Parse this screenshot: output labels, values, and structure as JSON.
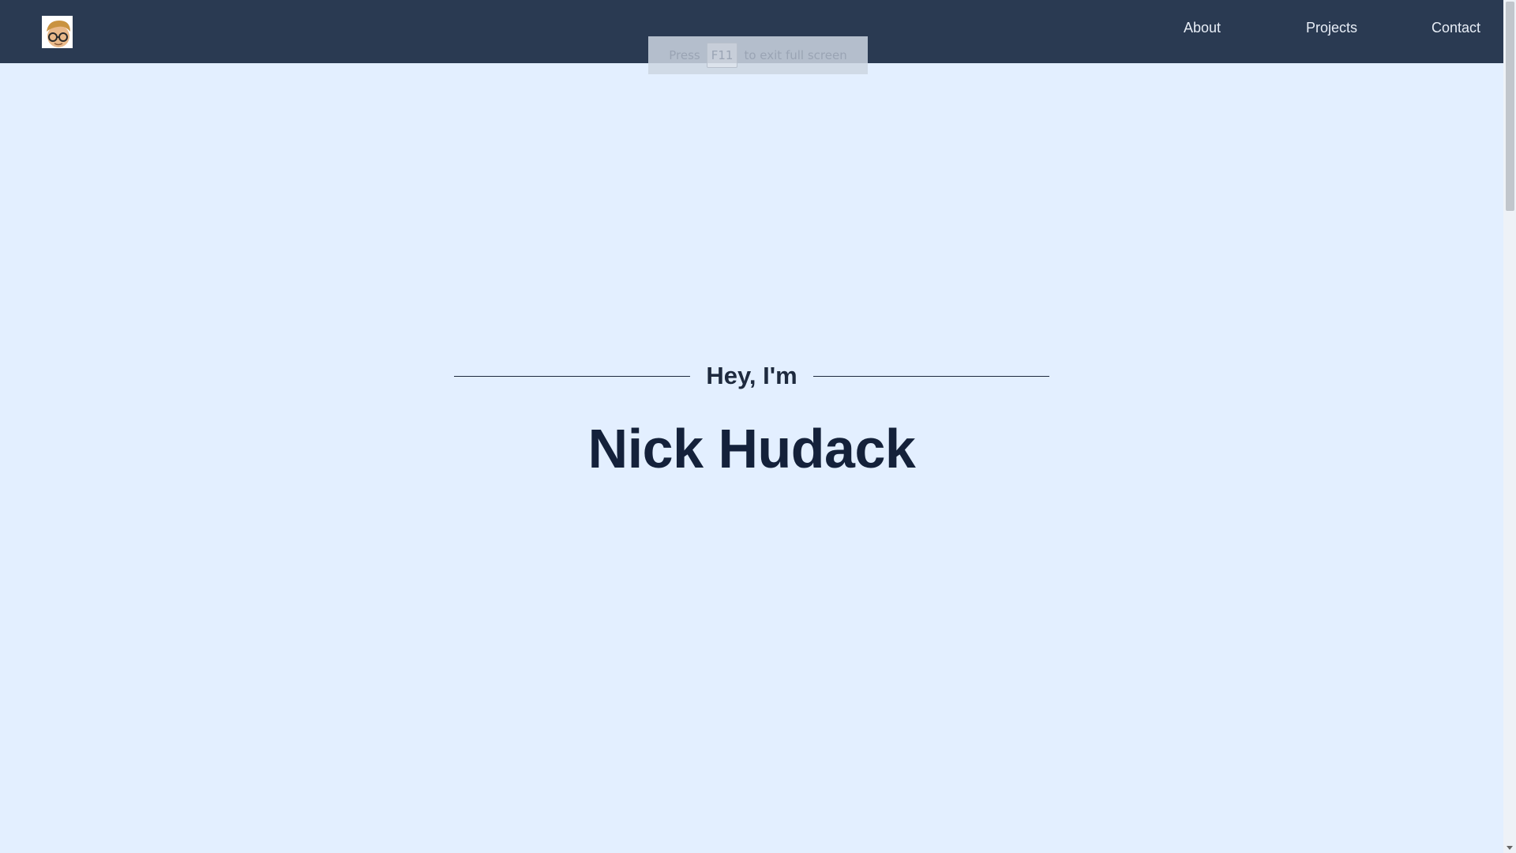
{
  "navbar": {
    "logo_alt": "avatar",
    "links": [
      {
        "label": "About"
      },
      {
        "label": "Projects"
      },
      {
        "label": "Contact"
      }
    ]
  },
  "fullscreen_toast": {
    "prefix": "Press",
    "key": "F11",
    "suffix": "to exit full screen"
  },
  "hero": {
    "eyebrow": "Hey, I'm",
    "name": "Nick Hudack"
  },
  "colors": {
    "navbar_bg": "#2a3a52",
    "page_bg": "#e3efff",
    "heading": "#14213a"
  }
}
